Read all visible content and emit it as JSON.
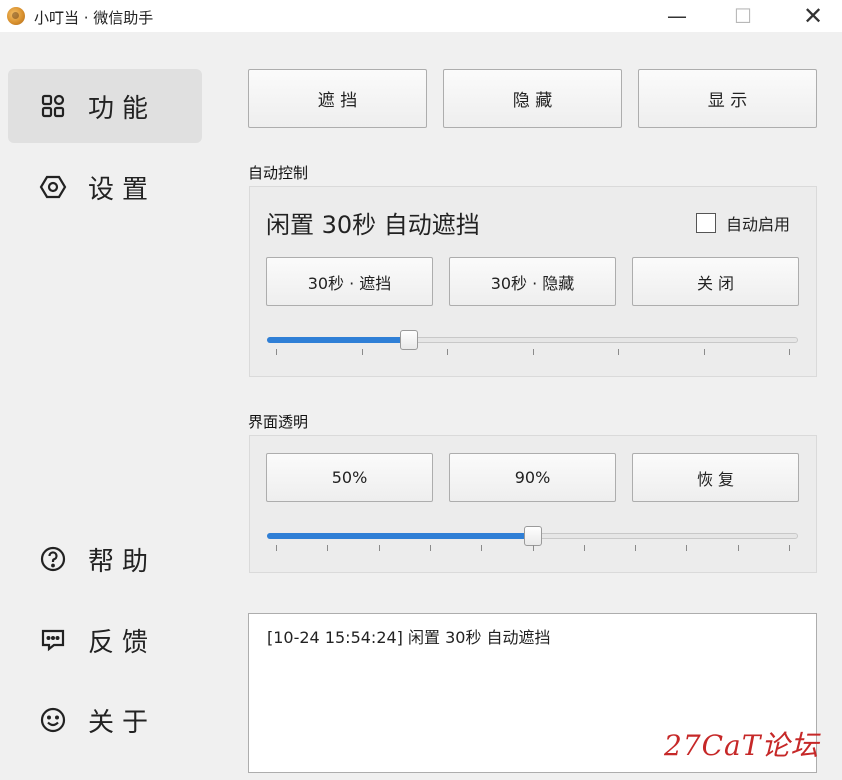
{
  "window": {
    "title": "小叮当 · 微信助手",
    "minimize": "—",
    "maximize": "☐",
    "close": "✕"
  },
  "sidebar": {
    "items": [
      {
        "label": "功能",
        "icon": "grid-icon",
        "active": true
      },
      {
        "label": "设置",
        "icon": "settings-icon",
        "active": false
      },
      {
        "label": "帮助",
        "icon": "help-icon",
        "active": false
      },
      {
        "label": "反馈",
        "icon": "feedback-icon",
        "active": false
      },
      {
        "label": "关于",
        "icon": "smiley-icon",
        "active": false
      }
    ]
  },
  "toolbar": {
    "mask_label": "遮 挡",
    "hide_label": "隐 藏",
    "show_label": "显 示"
  },
  "auto_control": {
    "label": "自动控制",
    "status": "闲置 30秒 自动遮挡",
    "checkbox_label": "自动启用",
    "checked": false,
    "buttons": [
      "30秒 · 遮挡",
      "30秒 · 隐藏",
      "关 闭"
    ],
    "slider_value": 0.26
  },
  "transparency": {
    "label": "界面透明",
    "buttons": [
      "50%",
      "90%",
      "恢 复"
    ],
    "slider_value": 0.5
  },
  "log": {
    "lines": [
      "[10-24 15:54:24]  闲置 30秒 自动遮挡"
    ]
  },
  "watermark": "27CaT论坛",
  "colors": {
    "accent": "#2f7fd6",
    "watermark": "#c62828"
  }
}
